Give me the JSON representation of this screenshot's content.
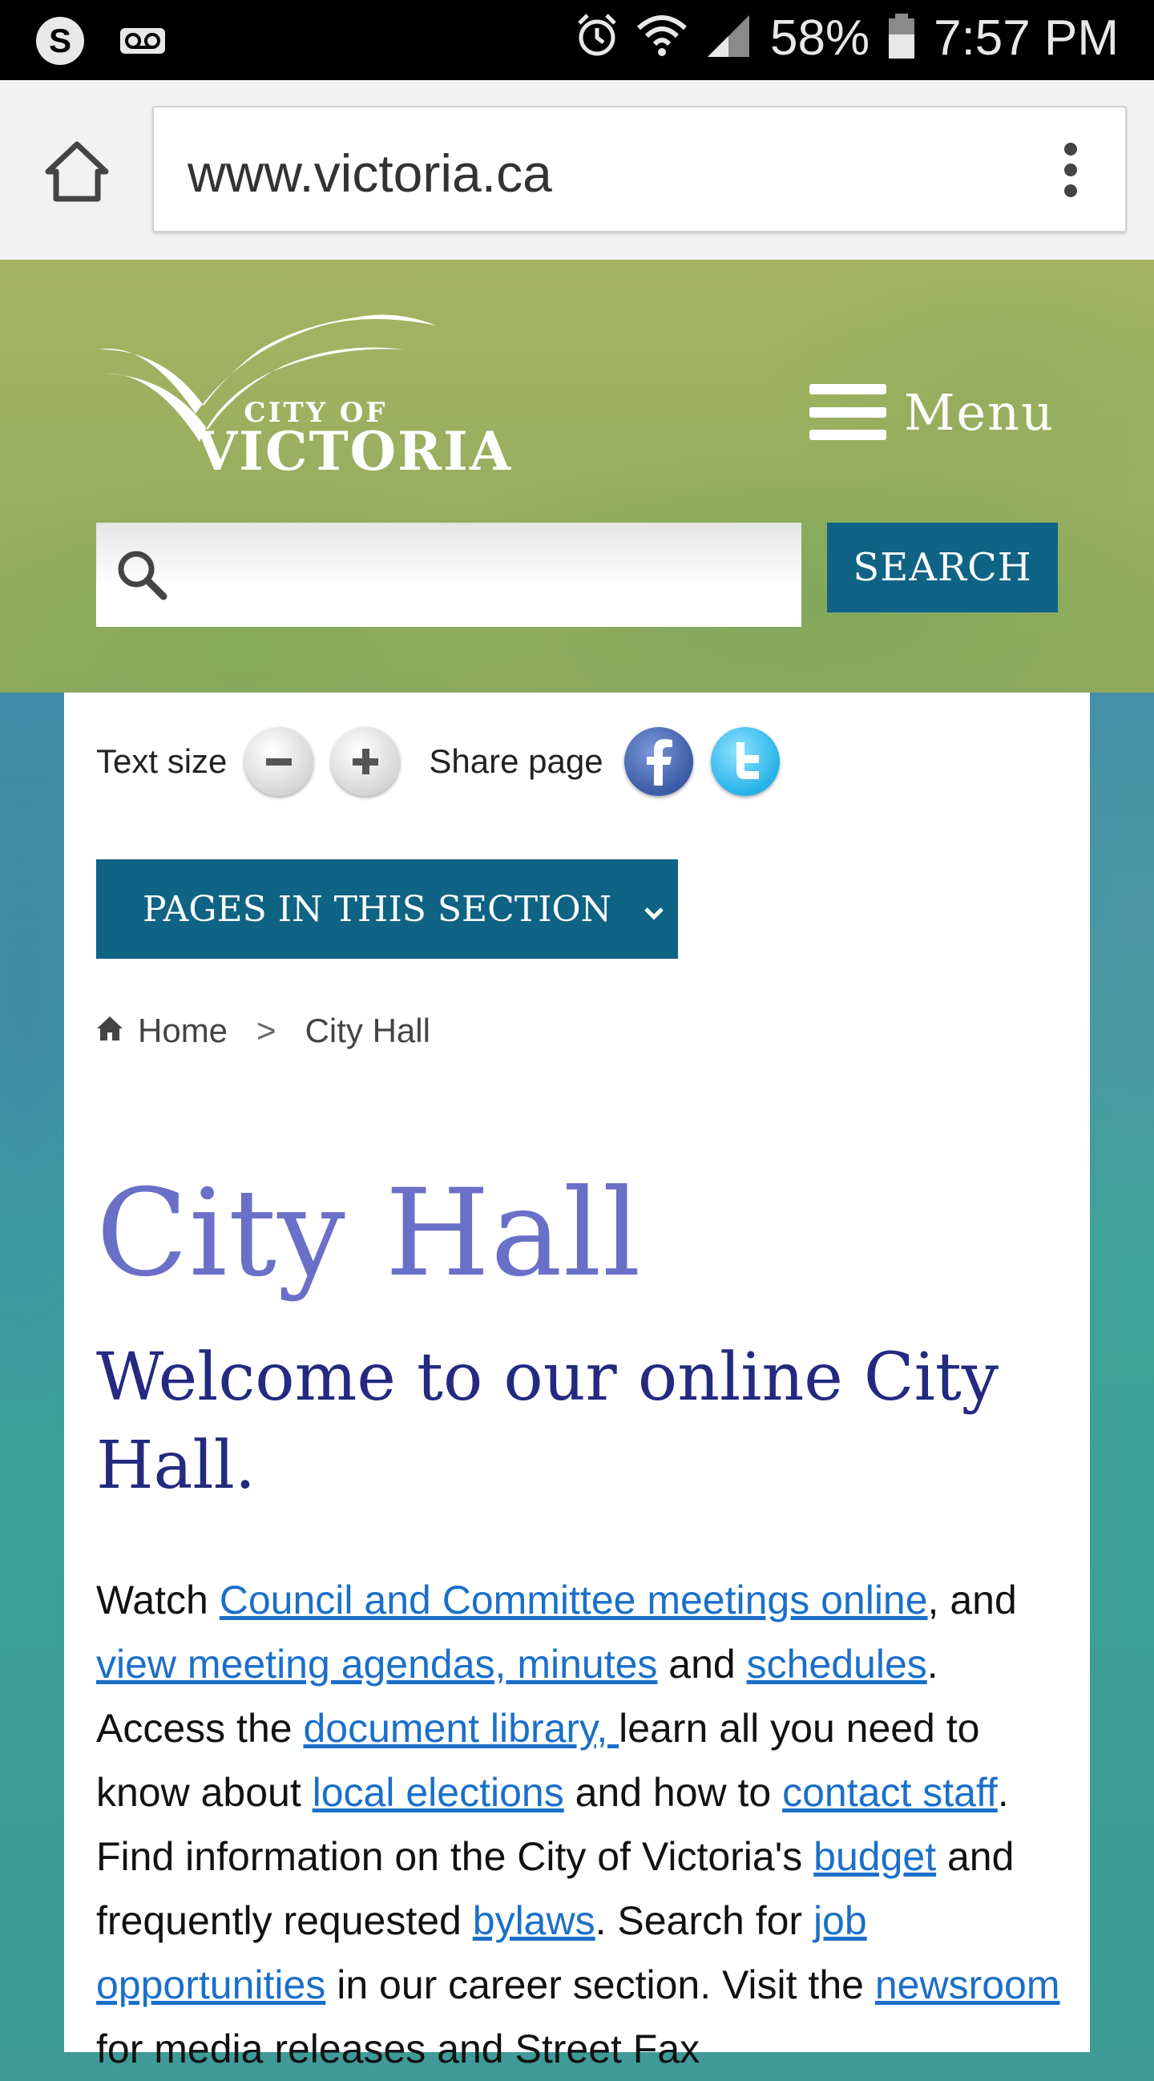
{
  "statusbar": {
    "battery_text": "58%",
    "time": "7:57 PM"
  },
  "browser": {
    "url": "www.victoria.ca"
  },
  "header": {
    "logo_line1": "CITY OF",
    "logo_line2": "VICTORIA",
    "menu_label": "Menu",
    "search_placeholder": "",
    "search_button": "SEARCH"
  },
  "tools": {
    "text_size_label": "Text size",
    "share_label": "Share page"
  },
  "section_button": "PAGES IN THIS SECTION",
  "breadcrumb": {
    "home": "Home",
    "separator": ">",
    "current": "City Hall"
  },
  "page_title": "City Hall",
  "welcome": "Welcome to our online City Hall.",
  "body": {
    "t1": "Watch ",
    "l1": "Council and Committee meetings online",
    "t2": ", and ",
    "l2": "view meeting agendas, minutes",
    "t3": " and ",
    "l3": "schedules",
    "t4": ". Access the ",
    "l4": "document library, ",
    "t5": "learn all you need to know about ",
    "l5": "local elections",
    "t6": " and how to ",
    "l6": "contact staff",
    "t7": ". Find information on the City of Victoria's ",
    "l7": "budget",
    "t8": " and frequently requested ",
    "l8": "bylaws",
    "t9": ". Search for ",
    "l9": "job opportunities",
    "t10": " in our career section. Visit the ",
    "l10": "newsroom",
    "t11": " for media releases and Street Fax"
  }
}
